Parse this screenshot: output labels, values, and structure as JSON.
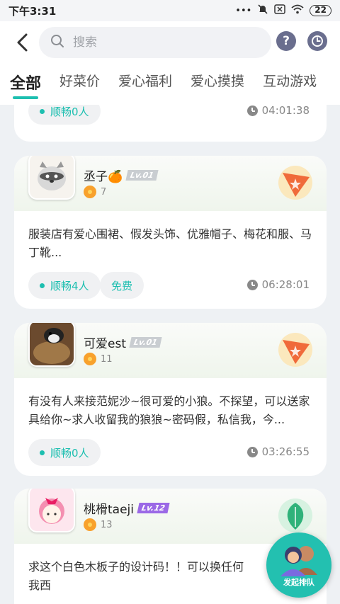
{
  "status": {
    "time": "下午3:31",
    "battery": "22"
  },
  "search": {
    "placeholder": "搜索"
  },
  "header": {
    "help_label": "?"
  },
  "tabs": [
    {
      "label": "全部"
    },
    {
      "label": "好菜价"
    },
    {
      "label": "爱心福利"
    },
    {
      "label": "爱心摸摸"
    },
    {
      "label": "互动游戏"
    }
  ],
  "posts": [
    {
      "tag": "顺畅0人",
      "time": "04:01:38"
    },
    {
      "username": "丞子🍊",
      "level": "Lv.01",
      "flowers": "7",
      "text": "服装店有爱心围裙、假发头饰、优雅帽子、梅花和服、马丁靴...",
      "tag": "顺畅4人",
      "extra_tag": "免费",
      "time": "06:28:01"
    },
    {
      "username": "可爱est",
      "level": "Lv.01",
      "flowers": "11",
      "text": "有没有人来接范妮沙~很可爱的小狼。不探望，可以送家具给你~求人收留我的狼狼~密码假，私信我，今...",
      "tag": "顺畅0人",
      "time": "03:26:55"
    },
    {
      "username": "桃榾taeji",
      "level": "Lv.12",
      "flowers": "13",
      "text": "求这个白色木板子的设计码！！可以换任何我西"
    }
  ],
  "fab": {
    "label": "发起排队"
  },
  "colors": {
    "accent": "#1dbfb0",
    "fab": "#23c0b0"
  }
}
